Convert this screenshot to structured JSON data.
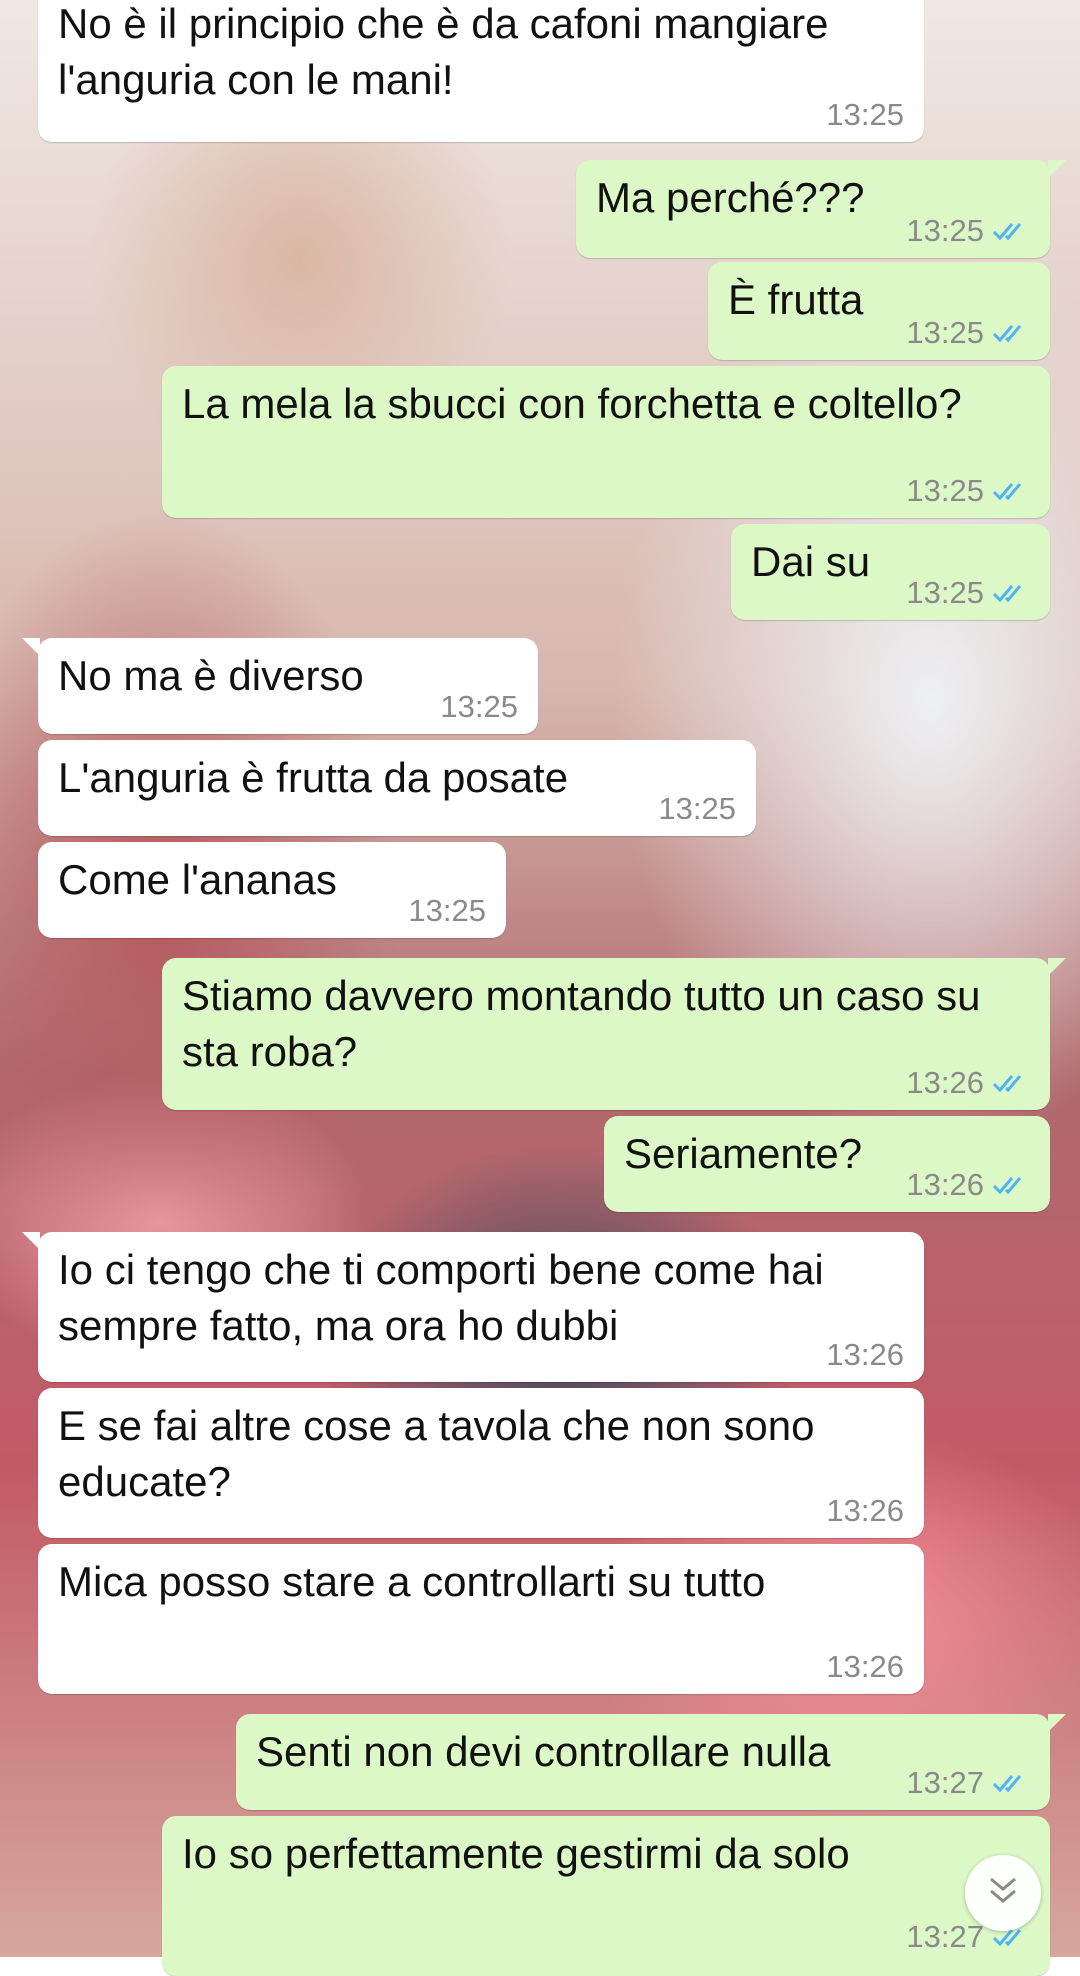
{
  "messages": [
    {
      "direction": "in",
      "text": "No è il principio che è da cafoni mangiare l'anguria con le mani!",
      "time": "13:25"
    },
    {
      "direction": "out",
      "text": "Ma perché???",
      "time": "13:25",
      "status": "read"
    },
    {
      "direction": "out",
      "text": "È frutta",
      "time": "13:25",
      "status": "read"
    },
    {
      "direction": "out",
      "text": "La mela la sbucci con forchetta e coltello?",
      "time": "13:25",
      "status": "read"
    },
    {
      "direction": "out",
      "text": "Dai su",
      "time": "13:25",
      "status": "read"
    },
    {
      "direction": "in",
      "text": "No ma è diverso",
      "time": "13:25"
    },
    {
      "direction": "in",
      "text": "L'anguria è frutta da posate",
      "time": "13:25"
    },
    {
      "direction": "in",
      "text": "Come l'ananas",
      "time": "13:25"
    },
    {
      "direction": "out",
      "text": "Stiamo davvero montando tutto un caso su sta roba?",
      "time": "13:26",
      "status": "read"
    },
    {
      "direction": "out",
      "text": "Seriamente?",
      "time": "13:26",
      "status": "read"
    },
    {
      "direction": "in",
      "text": "Io ci tengo che ti comporti bene come hai sempre fatto, ma ora ho dubbi",
      "time": "13:26"
    },
    {
      "direction": "in",
      "text": "E se fai altre cose a tavola che non sono educate?",
      "time": "13:26"
    },
    {
      "direction": "in",
      "text": "Mica posso stare a controllarti su tutto",
      "time": "13:26"
    },
    {
      "direction": "out",
      "text": "Senti non devi controllare nulla",
      "time": "13:27",
      "status": "read"
    },
    {
      "direction": "out",
      "text": "Io so perfettamente gestirmi da solo",
      "time": "13:27",
      "status": "read"
    }
  ],
  "colors": {
    "incoming_bubble": "#ffffff",
    "outgoing_bubble": "#dcf8c6",
    "read_ticks": "#4fb3f6",
    "timestamp": "#8a8a8a"
  },
  "icons": {
    "read_status": "double-check-icon",
    "scroll_down": "chevron-double-down-icon"
  }
}
